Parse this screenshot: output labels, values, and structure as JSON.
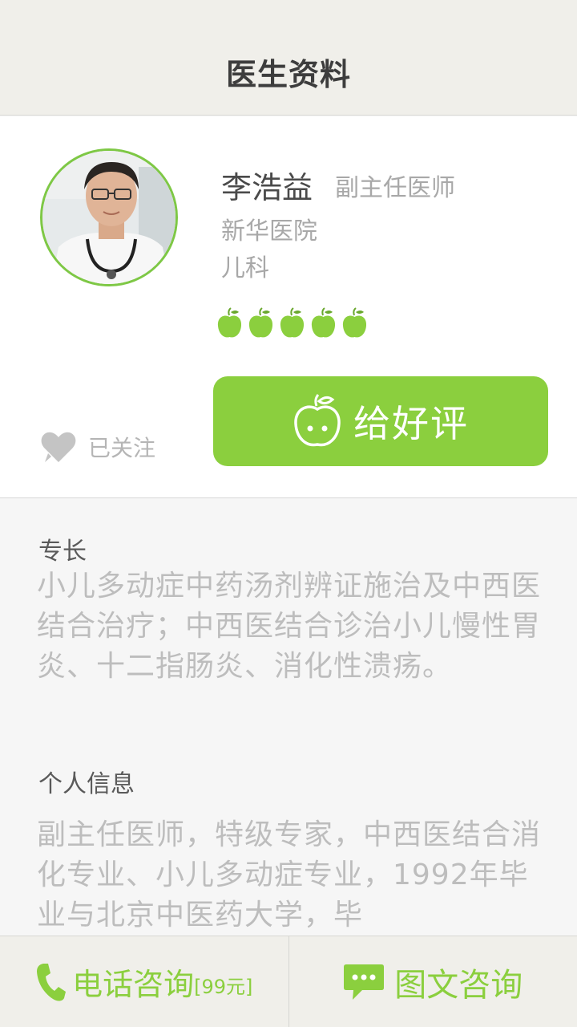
{
  "header": {
    "title": "医生资料"
  },
  "doctor": {
    "name": "李浩益",
    "title": "副主任医师",
    "hospital": "新华医院",
    "department": "儿科",
    "rating": 5,
    "follow_label": "已关注",
    "good_review_label": "给好评"
  },
  "details": {
    "specialty_heading": "专长",
    "specialty_text": "小儿多动症中药汤剂辨证施治及中西医结合治疗；中西医结合诊治小儿慢性胃炎、十二指肠炎、消化性溃疡。",
    "info_heading": "个人信息",
    "info_text": "副主任医师，特级专家，中西医结合消化专业、小儿多动症专业，1992年毕业与北京中医药大学，毕"
  },
  "bottom_bar": {
    "phone_label": "电话咨询",
    "phone_price": "[99元]",
    "chat_label": "图文咨询"
  },
  "colors": {
    "accent": "#8bcf3e",
    "header_bg": "#f0efea"
  }
}
